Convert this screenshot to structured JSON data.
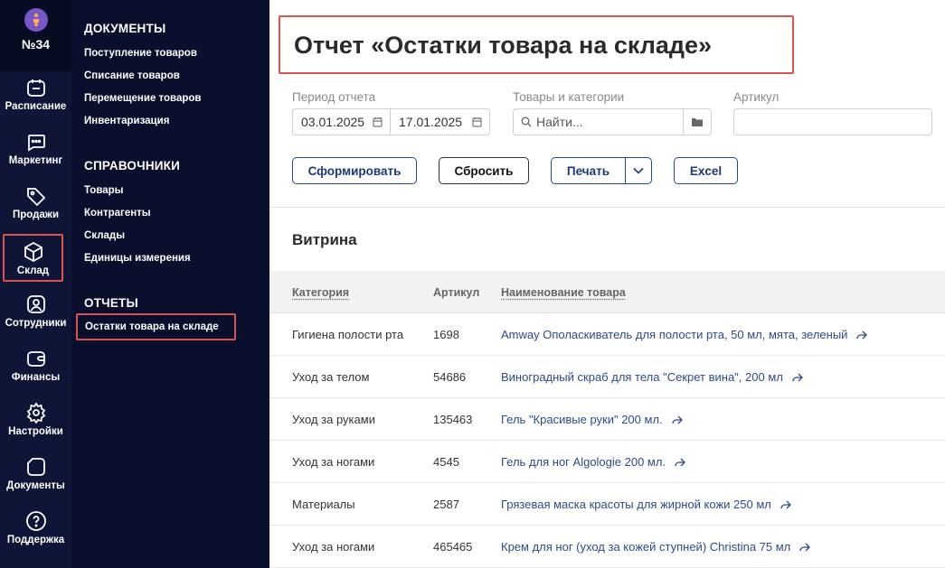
{
  "rail": {
    "brand": "№34",
    "items": [
      {
        "label": "Расписание",
        "icon": "calendar-icon"
      },
      {
        "label": "Маркетинг",
        "icon": "chat-icon"
      },
      {
        "label": "Продажи",
        "icon": "tag-icon"
      },
      {
        "label": "Склад",
        "icon": "box-icon",
        "active": true
      },
      {
        "label": "Сотрудники",
        "icon": "user-icon"
      },
      {
        "label": "Финансы",
        "icon": "wallet-icon"
      },
      {
        "label": "Настройки",
        "icon": "gear-icon"
      },
      {
        "label": "Документы",
        "icon": "document-icon"
      },
      {
        "label": "Поддержка",
        "icon": "help-icon"
      }
    ]
  },
  "subnav": {
    "documents": {
      "title": "ДОКУМЕНТЫ",
      "links": [
        "Поступление товаров",
        "Списание товаров",
        "Перемещение товаров",
        "Инвентаризация"
      ]
    },
    "references": {
      "title": "СПРАВОЧНИКИ",
      "links": [
        "Товары",
        "Контрагенты",
        "Склады",
        "Единицы измерения"
      ]
    },
    "reports": {
      "title": "ОТЧЕТЫ",
      "links": [
        "Остатки товара на складе"
      ]
    }
  },
  "page": {
    "title": "Отчет «Остатки товара на складе»"
  },
  "filters": {
    "period_label": "Период отчета",
    "date_from": "03.01.2025",
    "date_to": "17.01.2025",
    "goods_label": "Товары и категории",
    "goods_placeholder": "Найти...",
    "article_label": "Артикул",
    "article_value": ""
  },
  "actions": {
    "generate": "Сформировать",
    "reset": "Сбросить",
    "print": "Печать",
    "excel": "Excel"
  },
  "table": {
    "section_title": "Витрина",
    "headers": {
      "category": "Категория",
      "article": "Артикул",
      "name": "Наименование товара"
    },
    "rows": [
      {
        "category": "Гигиена полости рта",
        "article": "1698",
        "name": "Amway Ополаскиватель для полости рта, 50 мл, мята, зеленый"
      },
      {
        "category": "Уход за телом",
        "article": "54686",
        "name": "Виноградный скраб для тела \"Секрет вина\", 200 мл"
      },
      {
        "category": "Уход за руками",
        "article": "135463",
        "name": "Гель \"Красивые руки\" 200 мл."
      },
      {
        "category": "Уход за ногами",
        "article": "4545",
        "name": "Гель для ног Algologie 200 мл."
      },
      {
        "category": "Материалы",
        "article": "2587",
        "name": "Грязевая маска красоты для жирной кожи 250 мл"
      },
      {
        "category": "Уход за ногами",
        "article": "465465",
        "name": "Крем для ног (уход за кожей ступней) Christina 75 мл"
      }
    ]
  },
  "colors": {
    "rail": "#0e1536",
    "subnav": "#090f2c",
    "highlight": "#d9534f",
    "link": "#2d4a8a"
  }
}
